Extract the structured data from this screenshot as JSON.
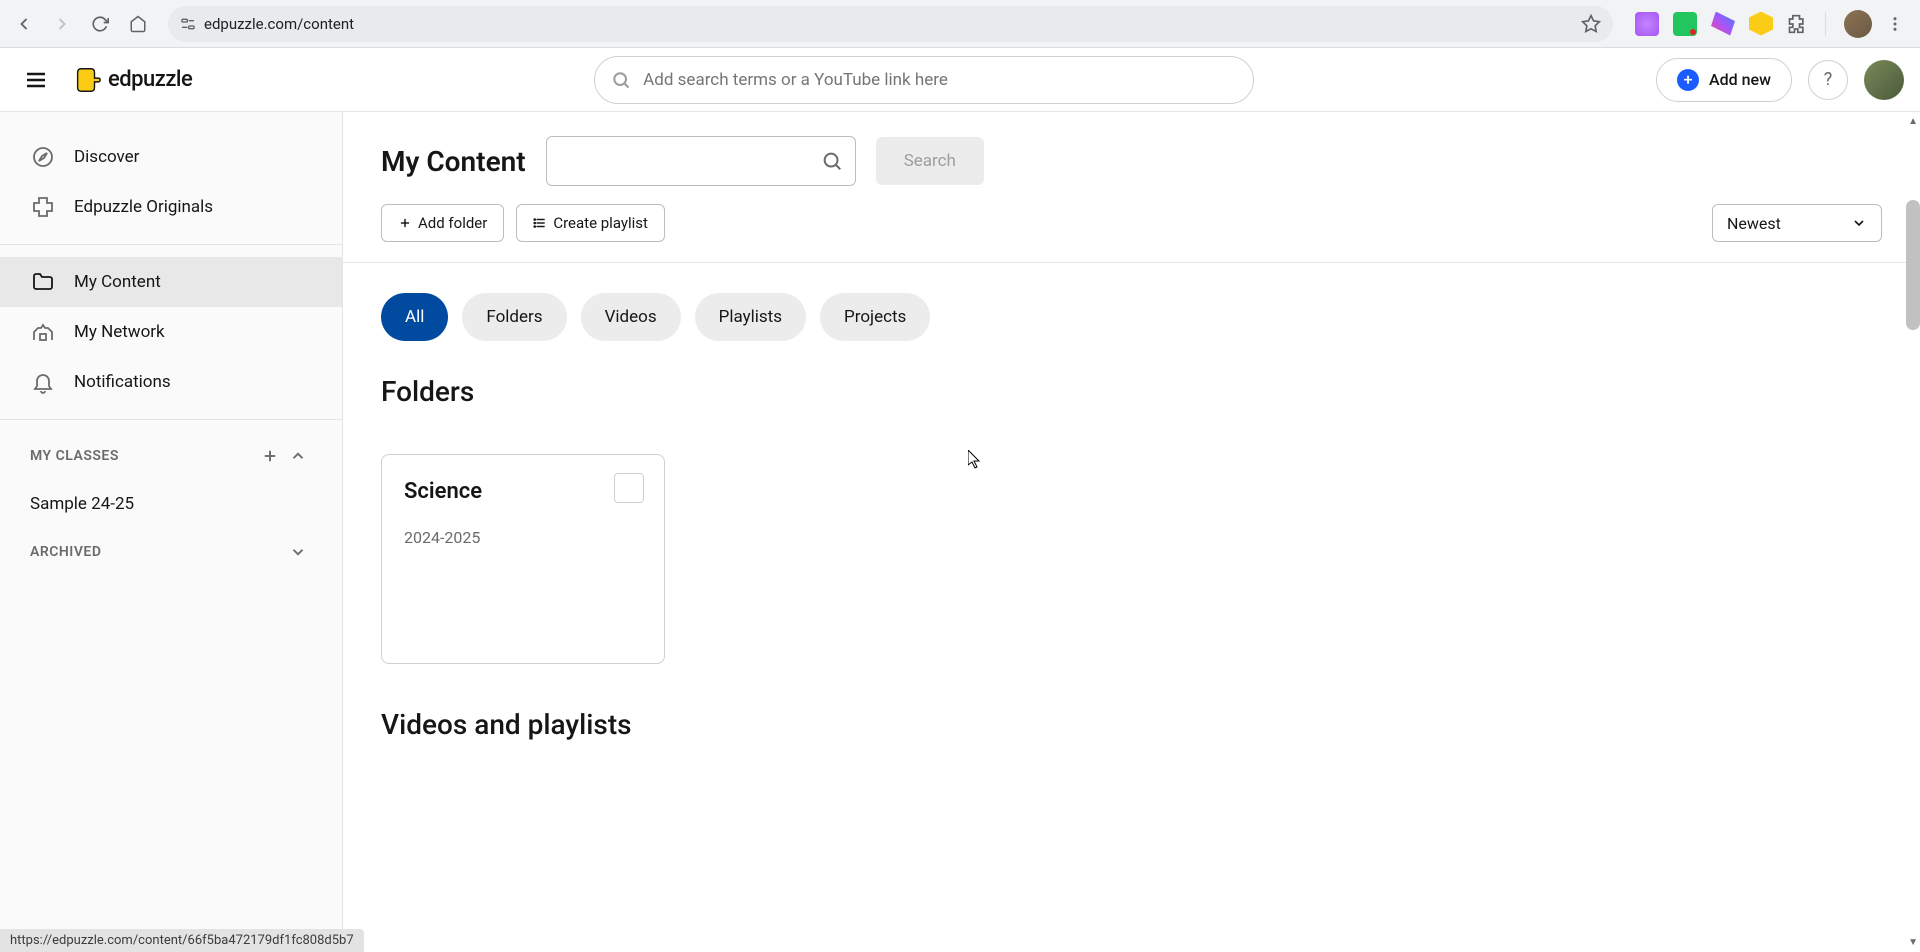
{
  "browser": {
    "url": "edpuzzle.com/content",
    "status_url": "https://edpuzzle.com/content/66f5ba472179df1fc808d5b7"
  },
  "header": {
    "logo_text": "edpuzzle",
    "search_placeholder": "Add search terms or a YouTube link here",
    "add_new_label": "Add new"
  },
  "sidebar": {
    "items": [
      {
        "label": "Discover",
        "icon": "compass"
      },
      {
        "label": "Edpuzzle Originals",
        "icon": "puzzle"
      },
      {
        "label": "My Content",
        "icon": "folder",
        "active": true
      },
      {
        "label": "My Network",
        "icon": "network"
      },
      {
        "label": "Notifications",
        "icon": "bell"
      }
    ],
    "classes_header": "MY CLASSES",
    "classes": [
      {
        "label": "Sample 24-25"
      }
    ],
    "archived_header": "ARCHIVED"
  },
  "main": {
    "title": "My Content",
    "search_btn": "Search",
    "add_folder": "Add folder",
    "create_playlist": "Create playlist",
    "sort": "Newest",
    "chips": [
      "All",
      "Folders",
      "Videos",
      "Playlists",
      "Projects"
    ],
    "active_chip": "All",
    "folders_title": "Folders",
    "folders": [
      {
        "name": "Science",
        "meta": "2024-2025"
      }
    ],
    "videos_title": "Videos and playlists"
  }
}
